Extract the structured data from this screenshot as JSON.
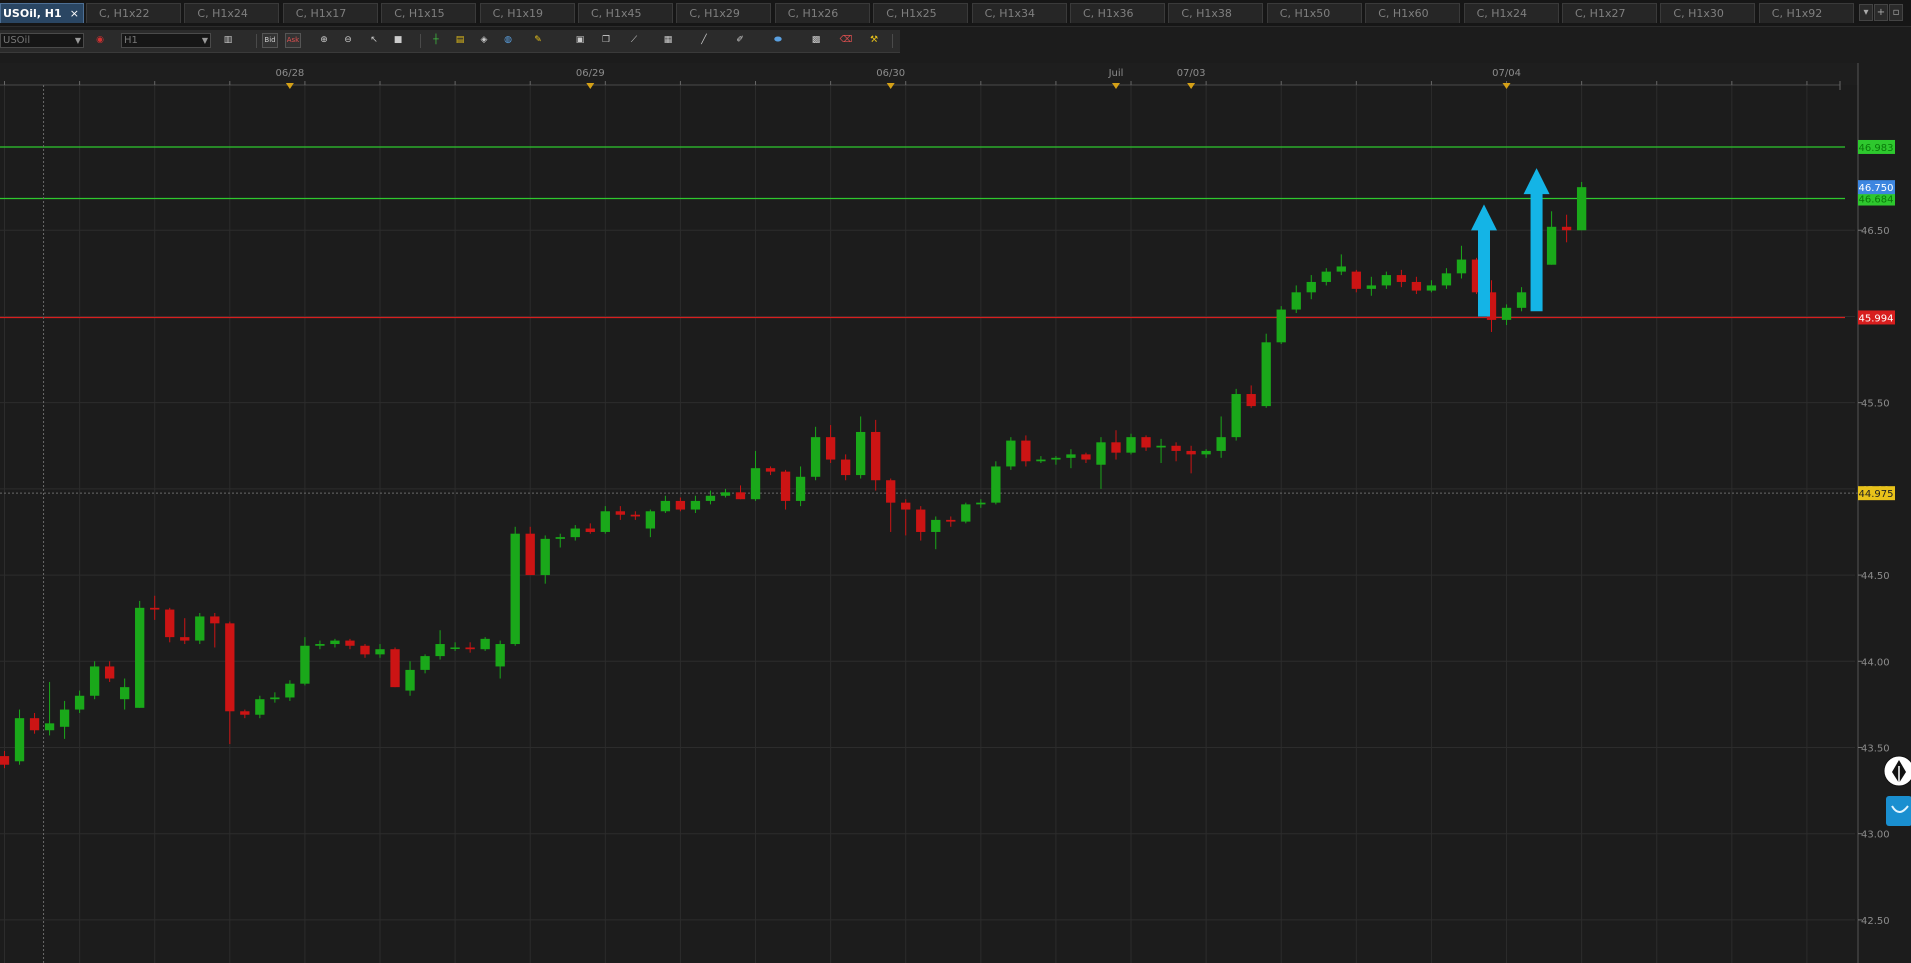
{
  "window": {
    "active_tab": {
      "label": "USOil, H1",
      "close": "×"
    },
    "tabs": [
      "C, H1x22",
      "C, H1x24",
      "C, H1x17",
      "C, H1x15",
      "C, H1x19",
      "C, H1x45",
      "C, H1x29",
      "C, H1x26",
      "C, H1x25",
      "C, H1x34",
      "C, H1x36",
      "C, H1x38",
      "C, H1x50",
      "C, H1x60",
      "C, H1x24",
      "C, H1x27",
      "C, H1x30",
      "C, H1x92"
    ],
    "tab_controls": [
      "▾",
      "+",
      "▫"
    ]
  },
  "toolbar": {
    "symbol_value": "USOil",
    "timeframe_value": "H1",
    "bid_label": "Bid",
    "ask_label": "Ask",
    "icons": [
      "chart-type-icon",
      "zoom-in-icon",
      "zoom-out-icon",
      "cursor-icon",
      "stop-icon",
      "crosshair-icon",
      "pencil-icon",
      "layers-icon",
      "magnifier-icon",
      "highlighter-icon",
      "image-icon",
      "window-icon",
      "line-tool-icon",
      "grid-icon",
      "trend-line-icon",
      "pen-icon",
      "ellipse-icon",
      "calendar-icon",
      "eraser-icon",
      "tools-icon"
    ]
  },
  "colors": {
    "background": "#1c1c1c",
    "bull": "#1aa81a",
    "bear": "#cc1414",
    "grid": "#2c2c2c",
    "resistance": "#2ec82e",
    "support": "#d81e1e",
    "arrow": "#14b4e6",
    "current_price_bg": "#3d86e0",
    "crosshair_label_bg": "#e8c21a",
    "date_marker": "#d4a017"
  },
  "chart_data": {
    "type": "candlestick",
    "symbol": "USOil",
    "timeframe": "H1",
    "y_axis": {
      "ticks": [
        46.5,
        46.0,
        45.5,
        45.0,
        44.5,
        44.0,
        43.5,
        43.0,
        42.5
      ],
      "ylim": [
        42.25,
        47.47
      ]
    },
    "y_tick_labels": [
      "46.50",
      "46.00",
      "45.50",
      "45.00",
      "44.50",
      "44.00",
      "43.50",
      "43.00",
      "42.50"
    ],
    "x_axis": {
      "labels": [
        {
          "label": "06/28",
          "index": 19
        },
        {
          "label": "06/29",
          "index": 39
        },
        {
          "label": "06/30",
          "index": 59
        },
        {
          "label": "Juil",
          "index": 74
        },
        {
          "label": "07/03",
          "index": 79
        },
        {
          "label": "07/04",
          "index": 100
        }
      ]
    },
    "x_range": [
      -0.3,
      123.4
    ],
    "grid": true,
    "horizontal_levels": [
      {
        "name": "resistance-2",
        "price": 46.983,
        "label": "46.983",
        "color": "#2ec82e"
      },
      {
        "name": "resistance-1",
        "price": 46.684,
        "label": "46.684",
        "color": "#2ec82e"
      },
      {
        "name": "support",
        "price": 45.994,
        "label": "45.994",
        "color": "#d81e1e"
      }
    ],
    "current_price": {
      "price": 46.75,
      "label": "46.750"
    },
    "crosshair": {
      "price": 44.975,
      "label": "44.975",
      "index": 2.6
    },
    "arrows": [
      {
        "index": 98.5,
        "from": 46.0,
        "to": 46.65
      },
      {
        "index": 102,
        "from": 46.03,
        "to": 46.86
      }
    ],
    "candles": [
      [
        43.45,
        43.48,
        43.38,
        43.4
      ],
      [
        43.42,
        43.72,
        43.4,
        43.67
      ],
      [
        43.67,
        43.7,
        43.58,
        43.6
      ],
      [
        43.6,
        43.88,
        43.57,
        43.64
      ],
      [
        43.62,
        43.77,
        43.55,
        43.72
      ],
      [
        43.72,
        43.83,
        43.7,
        43.8
      ],
      [
        43.8,
        44.0,
        43.78,
        43.97
      ],
      [
        43.97,
        44.0,
        43.88,
        43.9
      ],
      [
        43.78,
        43.9,
        43.72,
        43.85
      ],
      [
        43.73,
        44.35,
        43.73,
        44.31
      ],
      [
        44.31,
        44.38,
        44.24,
        44.3
      ],
      [
        44.3,
        44.31,
        44.11,
        44.14
      ],
      [
        44.14,
        44.25,
        44.1,
        44.12
      ],
      [
        44.12,
        44.28,
        44.1,
        44.26
      ],
      [
        44.26,
        44.28,
        44.08,
        44.22
      ],
      [
        44.22,
        44.23,
        43.52,
        43.71
      ],
      [
        43.71,
        43.72,
        43.67,
        43.69
      ],
      [
        43.69,
        43.8,
        43.67,
        43.78
      ],
      [
        43.78,
        43.82,
        43.76,
        43.79
      ],
      [
        43.79,
        43.89,
        43.77,
        43.87
      ],
      [
        43.87,
        44.14,
        43.86,
        44.09
      ],
      [
        44.09,
        44.12,
        44.07,
        44.1
      ],
      [
        44.1,
        44.13,
        44.08,
        44.12
      ],
      [
        44.12,
        44.13,
        44.07,
        44.09
      ],
      [
        44.09,
        44.1,
        44.02,
        44.04
      ],
      [
        44.04,
        44.1,
        44.02,
        44.07
      ],
      [
        44.07,
        44.08,
        43.85,
        43.85
      ],
      [
        43.83,
        44.0,
        43.8,
        43.95
      ],
      [
        43.95,
        44.04,
        43.93,
        44.03
      ],
      [
        44.03,
        44.18,
        44.01,
        44.1
      ],
      [
        44.08,
        44.11,
        44.06,
        44.08
      ],
      [
        44.08,
        44.11,
        44.05,
        44.07
      ],
      [
        44.07,
        44.14,
        44.06,
        44.13
      ],
      [
        43.97,
        44.12,
        43.9,
        44.1
      ],
      [
        44.1,
        44.78,
        44.09,
        44.74
      ],
      [
        44.74,
        44.78,
        44.5,
        44.5
      ],
      [
        44.5,
        44.73,
        44.45,
        44.71
      ],
      [
        44.71,
        44.74,
        44.66,
        44.72
      ],
      [
        44.72,
        44.79,
        44.7,
        44.77
      ],
      [
        44.77,
        44.8,
        44.74,
        44.75
      ],
      [
        44.75,
        44.9,
        44.74,
        44.87
      ],
      [
        44.87,
        44.9,
        44.82,
        44.85
      ],
      [
        44.85,
        44.87,
        44.82,
        44.84
      ],
      [
        44.77,
        44.88,
        44.72,
        44.87
      ],
      [
        44.87,
        44.96,
        44.86,
        44.93
      ],
      [
        44.93,
        44.95,
        44.87,
        44.88
      ],
      [
        44.88,
        44.96,
        44.86,
        44.93
      ],
      [
        44.93,
        44.99,
        44.91,
        44.96
      ],
      [
        44.96,
        45.0,
        44.95,
        44.98
      ],
      [
        44.98,
        45.02,
        44.94,
        44.94
      ],
      [
        44.94,
        45.22,
        44.93,
        45.12
      ],
      [
        45.12,
        45.13,
        45.08,
        45.1
      ],
      [
        45.1,
        45.11,
        44.88,
        44.93
      ],
      [
        44.93,
        45.13,
        44.9,
        45.07
      ],
      [
        45.07,
        45.36,
        45.05,
        45.3
      ],
      [
        45.3,
        45.37,
        45.15,
        45.17
      ],
      [
        45.17,
        45.2,
        45.05,
        45.08
      ],
      [
        45.08,
        45.42,
        45.06,
        45.33
      ],
      [
        45.33,
        45.4,
        44.99,
        45.05
      ],
      [
        45.05,
        45.06,
        44.75,
        44.92
      ],
      [
        44.92,
        44.94,
        44.73,
        44.88
      ],
      [
        44.88,
        44.9,
        44.7,
        44.75
      ],
      [
        44.75,
        44.84,
        44.65,
        44.82
      ],
      [
        44.82,
        44.84,
        44.78,
        44.81
      ],
      [
        44.81,
        44.92,
        44.8,
        44.91
      ],
      [
        44.91,
        44.94,
        44.89,
        44.92
      ],
      [
        44.92,
        45.16,
        44.91,
        45.13
      ],
      [
        45.13,
        45.3,
        45.11,
        45.28
      ],
      [
        45.28,
        45.31,
        45.13,
        45.16
      ],
      [
        45.16,
        45.19,
        45.15,
        45.17
      ],
      [
        45.17,
        45.19,
        45.14,
        45.18
      ],
      [
        45.18,
        45.23,
        45.12,
        45.2
      ],
      [
        45.2,
        45.21,
        45.15,
        45.17
      ],
      [
        45.14,
        45.3,
        45.0,
        45.27
      ],
      [
        45.27,
        45.34,
        45.17,
        45.21
      ],
      [
        45.21,
        45.32,
        45.2,
        45.3
      ],
      [
        45.3,
        45.31,
        45.22,
        45.24
      ],
      [
        45.24,
        45.29,
        45.15,
        45.25
      ],
      [
        45.25,
        45.27,
        45.16,
        45.22
      ],
      [
        45.22,
        45.25,
        45.09,
        45.2
      ],
      [
        45.2,
        45.23,
        45.18,
        45.22
      ],
      [
        45.22,
        45.42,
        45.18,
        45.3
      ],
      [
        45.3,
        45.58,
        45.28,
        45.55
      ],
      [
        45.55,
        45.6,
        45.47,
        45.48
      ],
      [
        45.48,
        45.9,
        45.47,
        45.85
      ],
      [
        45.85,
        46.06,
        45.84,
        46.04
      ],
      [
        46.04,
        46.18,
        46.02,
        46.14
      ],
      [
        46.14,
        46.24,
        46.1,
        46.2
      ],
      [
        46.2,
        46.28,
        46.18,
        46.26
      ],
      [
        46.26,
        46.36,
        46.24,
        46.29
      ],
      [
        46.26,
        46.27,
        46.14,
        46.16
      ],
      [
        46.16,
        46.23,
        46.12,
        46.18
      ],
      [
        46.18,
        46.26,
        46.16,
        46.24
      ],
      [
        46.24,
        46.27,
        46.17,
        46.2
      ],
      [
        46.2,
        46.23,
        46.13,
        46.15
      ],
      [
        46.15,
        46.21,
        46.14,
        46.18
      ],
      [
        46.18,
        46.28,
        46.16,
        46.25
      ],
      [
        46.25,
        46.41,
        46.22,
        46.33
      ],
      [
        46.33,
        46.34,
        46.13,
        46.14
      ],
      [
        46.14,
        46.21,
        45.91,
        45.98
      ],
      [
        45.98,
        46.07,
        45.95,
        46.05
      ],
      [
        46.05,
        46.17,
        46.03,
        46.14
      ],
      [
        46.14,
        46.36,
        46.07,
        46.3
      ],
      [
        46.3,
        46.61,
        46.3,
        46.52
      ],
      [
        46.52,
        46.59,
        46.43,
        46.5
      ],
      [
        46.5,
        46.78,
        46.5,
        46.75
      ]
    ]
  },
  "right_widgets": {
    "pen_icon": "pen-nib-icon",
    "smile_icon": "smile-icon"
  }
}
